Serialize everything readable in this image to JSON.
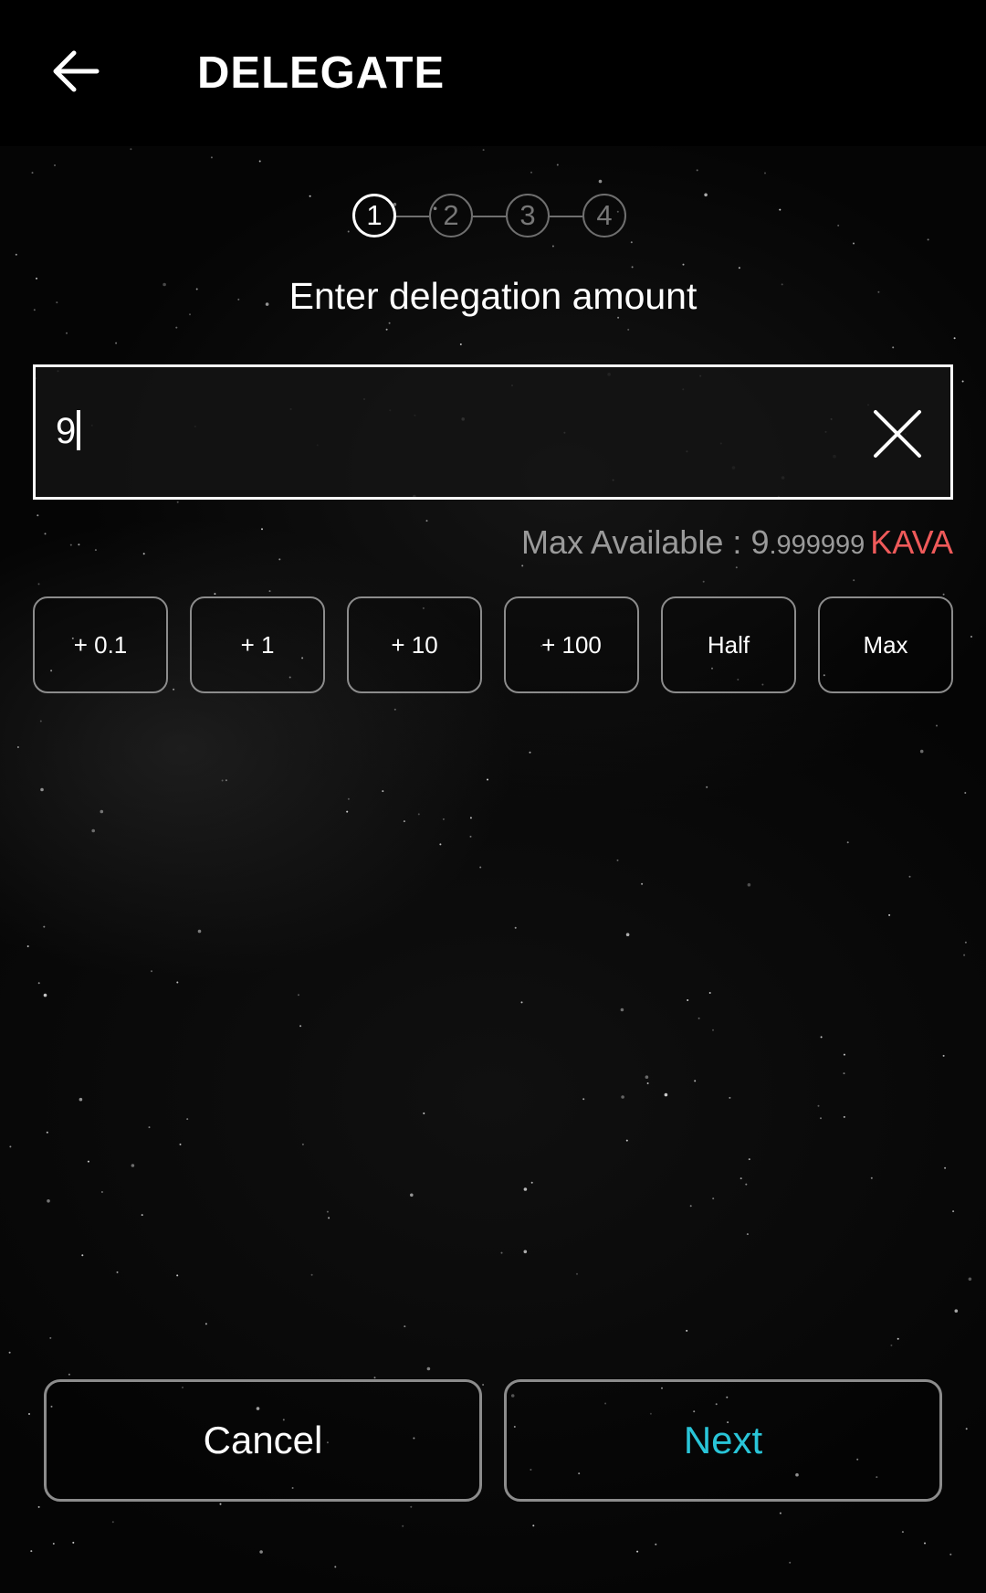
{
  "header": {
    "title": "DELEGATE",
    "back_icon": "arrow-left-icon"
  },
  "stepper": {
    "current_step": 1,
    "steps": [
      "1",
      "2",
      "3",
      "4"
    ]
  },
  "subtitle": "Enter delegation amount",
  "amount_input": {
    "value": "9",
    "clear_icon": "close-icon"
  },
  "max_available": {
    "label": "Max Available : ",
    "integer_part": "9",
    "decimal_part": ".999999",
    "denom": "KAVA"
  },
  "quick_buttons": [
    "+ 0.1",
    "+ 1",
    "+ 10",
    "+ 100",
    "Half",
    "Max"
  ],
  "footer": {
    "cancel_label": "Cancel",
    "next_label": "Next"
  },
  "colors": {
    "background": "#000000",
    "accent_next": "#29c5d8",
    "denom": "#ef5a5a",
    "muted_text": "#9a9a9a",
    "border": "#8c8c8c"
  }
}
